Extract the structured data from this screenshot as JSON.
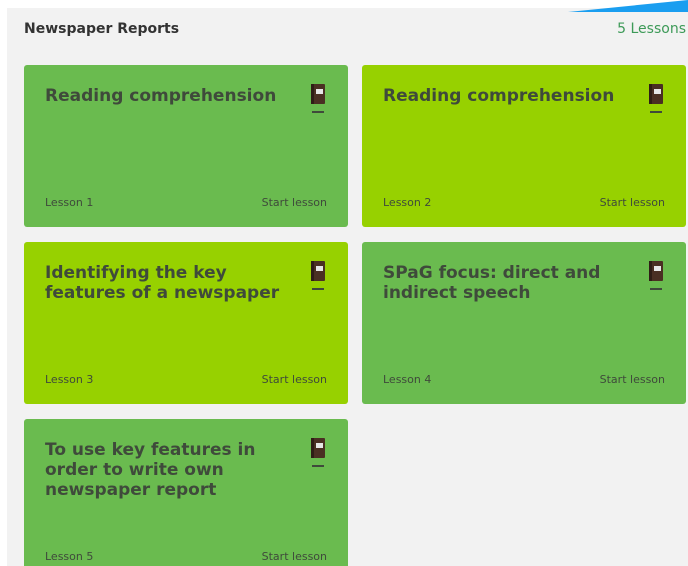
{
  "header": {
    "title": "Newspaper Reports",
    "count": "5 Lessons"
  },
  "colors": {
    "card_dark_green": "#6abb4f",
    "card_light_green": "#97d100",
    "count_text": "#3d9a58",
    "accent_blue": "#1a9ef0"
  },
  "lessons": [
    {
      "title": "Reading comprehension",
      "lesson_label": "Lesson 1",
      "action": "Start lesson",
      "icon": "book-icon",
      "tone": "dark"
    },
    {
      "title": "Reading comprehension",
      "lesson_label": "Lesson 2",
      "action": "Start lesson",
      "icon": "book-icon",
      "tone": "light"
    },
    {
      "title": "Identifying the key features of a newspaper",
      "lesson_label": "Lesson 3",
      "action": "Start lesson",
      "icon": "book-icon",
      "tone": "light"
    },
    {
      "title": "SPaG focus: direct and indirect speech",
      "lesson_label": "Lesson 4",
      "action": "Start lesson",
      "icon": "book-icon",
      "tone": "dark"
    },
    {
      "title": "To use key features in order to write own newspaper report",
      "lesson_label": "Lesson 5",
      "action": "Start lesson",
      "icon": "book-icon",
      "tone": "dark"
    }
  ]
}
